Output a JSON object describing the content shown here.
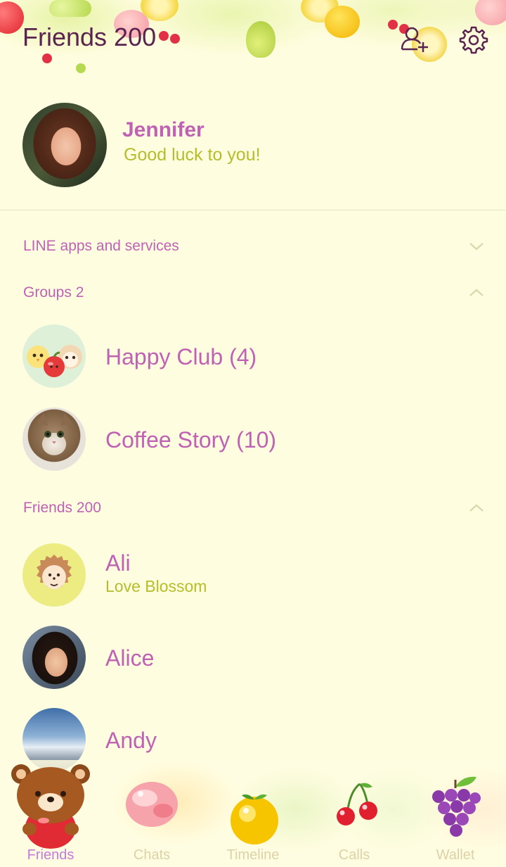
{
  "header": {
    "title": "Friends 200",
    "add_friend_icon": "add-friend-icon",
    "settings_icon": "gear-icon"
  },
  "profile": {
    "name": "Jennifer",
    "status": "Good luck to you!"
  },
  "sections": {
    "services": {
      "label": "LINE apps and services",
      "expanded": false
    },
    "groups": {
      "label": "Groups 2",
      "expanded": true
    },
    "friends": {
      "label": "Friends 200",
      "expanded": true
    }
  },
  "groups": [
    {
      "name": "Happy Club (4)"
    },
    {
      "name": "Coffee Story (10)"
    }
  ],
  "friends": [
    {
      "name": "Ali",
      "status": "Love Blossom"
    },
    {
      "name": "Alice",
      "status": ""
    },
    {
      "name": "Andy",
      "status": ""
    }
  ],
  "tabs": [
    {
      "label": "Friends",
      "active": true,
      "icon": "bear-apple-icon"
    },
    {
      "label": "Chats",
      "active": false,
      "icon": "peach-icon"
    },
    {
      "label": "Timeline",
      "active": false,
      "icon": "orange-icon"
    },
    {
      "label": "Calls",
      "active": false,
      "icon": "cherry-icon"
    },
    {
      "label": "Wallet",
      "active": false,
      "icon": "grapes-icon"
    }
  ],
  "colors": {
    "background": "#fffde0",
    "title": "#5a2450",
    "name": "#bf62b4",
    "status": "#b6bd2b",
    "tab_active": "#c57ad9",
    "tab_inactive": "#dcd2a8"
  }
}
